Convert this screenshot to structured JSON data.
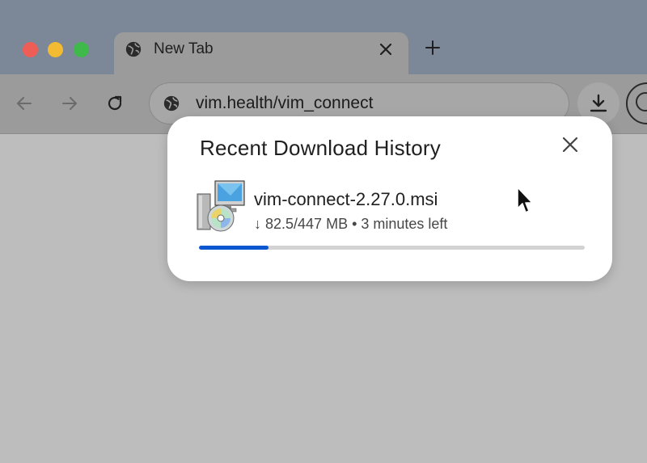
{
  "browser": {
    "tab": {
      "title": "New Tab"
    },
    "address_bar": {
      "url": "vim.health/vim_connect"
    }
  },
  "download_popup": {
    "title": "Recent Download History",
    "item": {
      "file_name": "vim-connect-2.27.0.msi",
      "status": "↓ 82.5/447 MB • 3 minutes left",
      "progress_fraction": 0.18,
      "icon": "installer-disc-icon"
    }
  },
  "colors": {
    "progress_fill": "#0b57d0",
    "progress_track": "#d3d3d3"
  }
}
